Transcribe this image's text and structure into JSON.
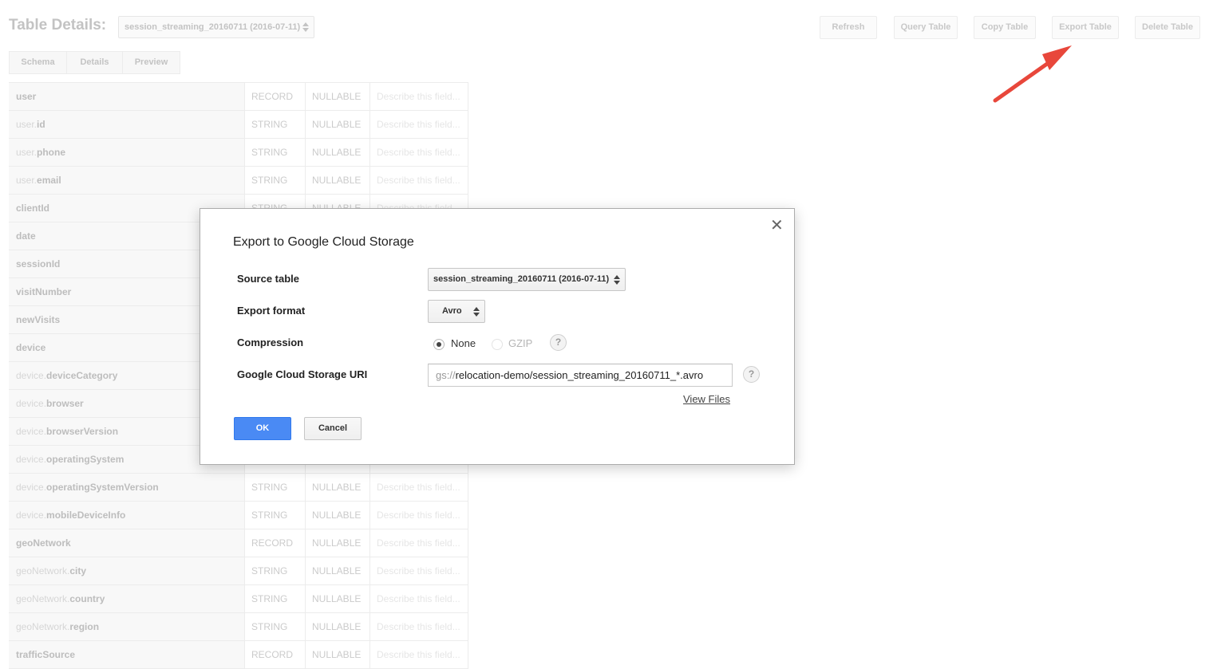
{
  "page": {
    "title": "Table Details:",
    "table_select_value": "session_streaming_20160711 (2016-07-11)",
    "actions": [
      "Refresh",
      "Query Table",
      "Copy Table",
      "Export Table",
      "Delete Table"
    ],
    "tabs": [
      "Schema",
      "Details",
      "Preview"
    ]
  },
  "schema": {
    "description_placeholder": "Describe this field...",
    "rows": [
      {
        "prefix": "",
        "name": "user",
        "type": "RECORD",
        "mode": "NULLABLE"
      },
      {
        "prefix": "user.",
        "name": "id",
        "type": "STRING",
        "mode": "NULLABLE"
      },
      {
        "prefix": "user.",
        "name": "phone",
        "type": "STRING",
        "mode": "NULLABLE"
      },
      {
        "prefix": "user.",
        "name": "email",
        "type": "STRING",
        "mode": "NULLABLE"
      },
      {
        "prefix": "",
        "name": "clientId",
        "type": "STRING",
        "mode": "NULLABLE"
      },
      {
        "prefix": "",
        "name": "date",
        "type": "",
        "mode": ""
      },
      {
        "prefix": "",
        "name": "sessionId",
        "type": "",
        "mode": ""
      },
      {
        "prefix": "",
        "name": "visitNumber",
        "type": "",
        "mode": ""
      },
      {
        "prefix": "",
        "name": "newVisits",
        "type": "",
        "mode": ""
      },
      {
        "prefix": "",
        "name": "device",
        "type": "",
        "mode": ""
      },
      {
        "prefix": "device.",
        "name": "deviceCategory",
        "type": "",
        "mode": ""
      },
      {
        "prefix": "device.",
        "name": "browser",
        "type": "",
        "mode": ""
      },
      {
        "prefix": "device.",
        "name": "browserVersion",
        "type": "",
        "mode": ""
      },
      {
        "prefix": "device.",
        "name": "operatingSystem",
        "type": "",
        "mode": ""
      },
      {
        "prefix": "device.",
        "name": "operatingSystemVersion",
        "type": "STRING",
        "mode": "NULLABLE"
      },
      {
        "prefix": "device.",
        "name": "mobileDeviceInfo",
        "type": "STRING",
        "mode": "NULLABLE"
      },
      {
        "prefix": "",
        "name": "geoNetwork",
        "type": "RECORD",
        "mode": "NULLABLE"
      },
      {
        "prefix": "geoNetwork.",
        "name": "city",
        "type": "STRING",
        "mode": "NULLABLE"
      },
      {
        "prefix": "geoNetwork.",
        "name": "country",
        "type": "STRING",
        "mode": "NULLABLE"
      },
      {
        "prefix": "geoNetwork.",
        "name": "region",
        "type": "STRING",
        "mode": "NULLABLE"
      },
      {
        "prefix": "",
        "name": "trafficSource",
        "type": "RECORD",
        "mode": "NULLABLE"
      }
    ]
  },
  "dialog": {
    "title": "Export to Google Cloud Storage",
    "close_symbol": "✕",
    "source_table_label": "Source table",
    "source_table_value": "session_streaming_20160711 (2016-07-11)",
    "export_format_label": "Export format",
    "export_format_value": "Avro",
    "compression_label": "Compression",
    "compression_options": [
      {
        "label": "None",
        "selected": true,
        "enabled": true
      },
      {
        "label": "GZIP",
        "selected": false,
        "enabled": false
      }
    ],
    "help_symbol": "?",
    "uri_label": "Google Cloud Storage URI",
    "uri_scheme": "gs://",
    "uri_path": "relocation-demo/session_streaming_20160711_*.avro",
    "view_files_label": "View Files",
    "ok_label": "OK",
    "cancel_label": "Cancel"
  },
  "colors": {
    "primary_button": "#4a8af4",
    "annotation_arrow": "#e8473b"
  }
}
